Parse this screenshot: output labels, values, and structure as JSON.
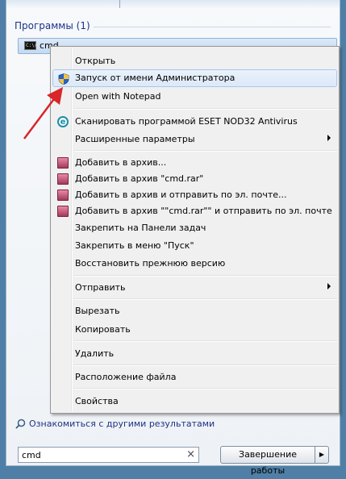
{
  "programs": {
    "header": "Программы (1)",
    "item_label": "cmd",
    "item_icon_text": "C:\\>"
  },
  "context_menu": {
    "items": [
      {
        "label": "Открыть"
      },
      {
        "label": "Запуск от имени Администратора",
        "icon": "uac-shield-icon",
        "highlighted": true
      },
      {
        "label": "Open with Notepad"
      },
      {
        "label": "Сканировать программой ESET NOD32 Antivirus",
        "icon": "eset-icon"
      },
      {
        "label": "Расширенные параметры",
        "submenu": true
      },
      {
        "label": "Добавить в архив...",
        "icon": "winrar-icon"
      },
      {
        "label": "Добавить в архив \"cmd.rar\"",
        "icon": "winrar-icon"
      },
      {
        "label": "Добавить в архив и отправить по эл. почте...",
        "icon": "winrar-icon"
      },
      {
        "label": "Добавить в архив \"\"cmd.rar\"\" и отправить по эл. почте",
        "icon": "winrar-icon"
      },
      {
        "label": "Закрепить на Панели задач"
      },
      {
        "label": "Закрепить в меню \"Пуск\""
      },
      {
        "label": "Восстановить прежнюю версию"
      },
      {
        "label": "Отправить",
        "submenu": true
      },
      {
        "label": "Вырезать"
      },
      {
        "label": "Копировать"
      },
      {
        "label": "Удалить"
      },
      {
        "label": "Расположение файла"
      },
      {
        "label": "Свойства"
      }
    ]
  },
  "search": {
    "more_results": "Ознакомиться с другими результатами",
    "value": "cmd",
    "clear_glyph": "×"
  },
  "shutdown": {
    "label": "Завершение работы",
    "arrow_glyph": "▶"
  },
  "colors": {
    "annotation_arrow": "#d8262a",
    "header_text": "#1e3287"
  }
}
